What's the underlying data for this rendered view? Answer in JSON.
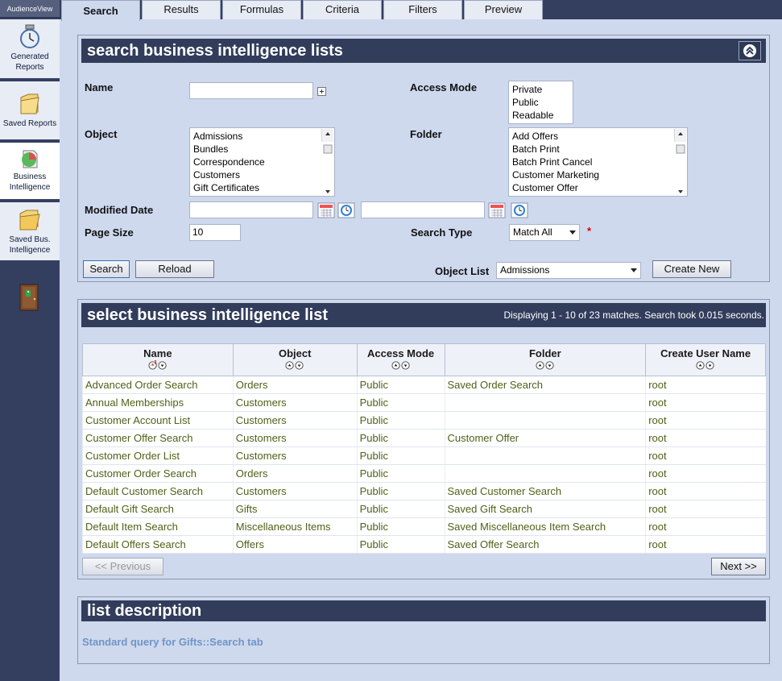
{
  "sidebar": {
    "brand": "AudienceView",
    "items": [
      {
        "label_line1": "Generated",
        "label_line2": "Reports",
        "icon": "clock-icon"
      },
      {
        "label_line1": "Saved Reports",
        "label_line2": "",
        "icon": "folder-icon"
      },
      {
        "label_line1": "Business",
        "label_line2": "Intelligence",
        "icon": "pie-chart-icon"
      },
      {
        "label_line1": "Saved Bus.",
        "label_line2": "Intelligence",
        "icon": "open-folder-icon"
      }
    ],
    "exit_icon": "exit-door-icon"
  },
  "tabs": [
    "Search",
    "Results",
    "Formulas",
    "Criteria",
    "Filters",
    "Preview"
  ],
  "search_panel": {
    "title": "search business intelligence lists",
    "labels": {
      "name": "Name",
      "access_mode": "Access Mode",
      "object": "Object",
      "folder": "Folder",
      "modified_date": "Modified Date",
      "page_size": "Page Size",
      "search_type": "Search Type",
      "object_list": "Object List"
    },
    "name_value": "",
    "access_modes": [
      "Private",
      "Public",
      "Readable"
    ],
    "objects": [
      "Admissions",
      "Bundles",
      "Correspondence",
      "Customers",
      "Gift Certificates"
    ],
    "folders": [
      "Add Offers",
      "Batch Print",
      "Batch Print Cancel",
      "Customer Marketing",
      "Customer Offer"
    ],
    "modified_from": "",
    "modified_to": "",
    "page_size": "10",
    "search_type": "Match All",
    "required_marker": "*",
    "object_list_value": "Admissions",
    "buttons": {
      "search": "Search",
      "reload": "Reload",
      "create_new": "Create New"
    }
  },
  "results_panel": {
    "title": "select business intelligence list",
    "status": "Displaying 1 - 10 of 23 matches. Search took 0.015 seconds.",
    "columns": [
      "Name",
      "Object",
      "Access Mode",
      "Folder",
      "Create User Name"
    ],
    "rows": [
      [
        "Advanced Order Search",
        "Orders",
        "Public",
        "Saved Order Search",
        "root"
      ],
      [
        "Annual Memberships",
        "Customers",
        "Public",
        "",
        "root"
      ],
      [
        "Customer Account List",
        "Customers",
        "Public",
        "",
        "root"
      ],
      [
        "Customer Offer Search",
        "Customers",
        "Public",
        "Customer Offer",
        "root"
      ],
      [
        "Customer Order List",
        "Customers",
        "Public",
        "",
        "root"
      ],
      [
        "Customer Order Search",
        "Orders",
        "Public",
        "",
        "root"
      ],
      [
        "Default Customer Search",
        "Customers",
        "Public",
        "Saved Customer Search",
        "root"
      ],
      [
        "Default Gift Search",
        "Gifts",
        "Public",
        "Saved Gift Search",
        "root"
      ],
      [
        "Default Item Search",
        "Miscellaneous Items",
        "Public",
        "Saved Miscellaneous Item Search",
        "root"
      ],
      [
        "Default Offers Search",
        "Offers",
        "Public",
        "Saved Offer Search",
        "root"
      ]
    ],
    "prev_label": "<< Previous",
    "next_label": "Next >>"
  },
  "description_panel": {
    "title": "list description",
    "text": "Standard query for Gifts::Search tab"
  }
}
